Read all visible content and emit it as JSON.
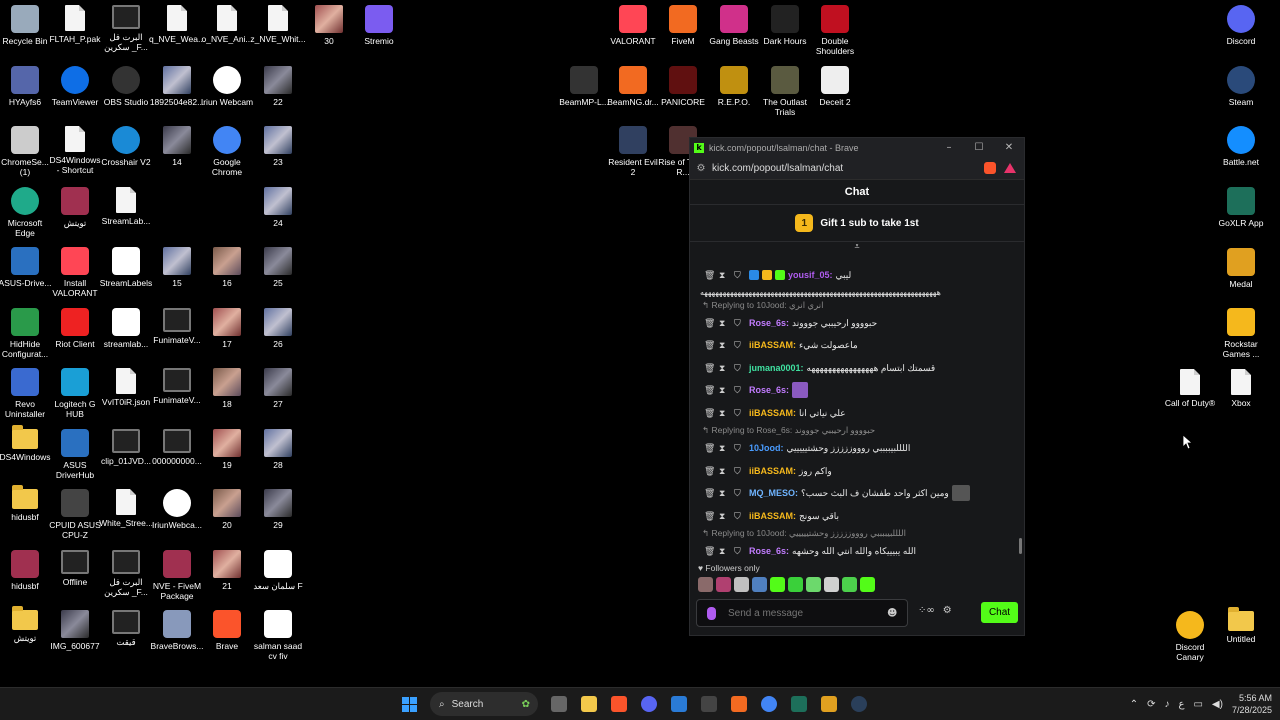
{
  "desktop": {
    "icons_left": [
      {
        "label": "Recycle Bin",
        "icon": "recycle-bin-icon"
      },
      {
        "label": "FLTAH_P.pak",
        "icon": "file-icon"
      },
      {
        "label": "البرت فل سكرين _F...",
        "icon": "video-icon"
      },
      {
        "label": "q_NVE_Wea...",
        "icon": "file-icon"
      },
      {
        "label": "o_NVE_Ani...",
        "icon": "file-icon"
      },
      {
        "label": "z_NVE_Whit...",
        "icon": "file-icon"
      },
      {
        "label": "30",
        "icon": "photo-icon"
      },
      {
        "label": "Stremio",
        "icon": "stremio-icon"
      },
      {
        "label": "HYAyfs6",
        "icon": "app-icon"
      },
      {
        "label": "TeamViewer",
        "icon": "teamviewer-icon"
      },
      {
        "label": "OBS Studio",
        "icon": "obs-icon"
      },
      {
        "label": "1892504e82...",
        "icon": "photo-icon"
      },
      {
        "label": "Iriun Webcam",
        "icon": "iriun-icon"
      },
      {
        "label": "22",
        "icon": "photo-icon"
      },
      {
        "label": "ChromeSe... (1)",
        "icon": "chrome-setup-icon"
      },
      {
        "label": "DS4Windows - Shortcut",
        "icon": "file-icon"
      },
      {
        "label": "Crosshair V2",
        "icon": "crosshair-icon"
      },
      {
        "label": "14",
        "icon": "photo-icon"
      },
      {
        "label": "Google Chrome",
        "icon": "chrome-icon"
      },
      {
        "label": "23",
        "icon": "photo-icon"
      },
      {
        "label": "Microsoft Edge",
        "icon": "edge-icon"
      },
      {
        "label": "تويتش",
        "icon": "winrar-icon"
      },
      {
        "label": "StreamLab...",
        "icon": "file-icon"
      },
      {
        "label": "24",
        "icon": "photo-icon"
      },
      {
        "label": "ASUS-Drive...",
        "icon": "asus-icon"
      },
      {
        "label": "Install VALORANT",
        "icon": "valorant-icon"
      },
      {
        "label": "StreamLabels",
        "icon": "streamlabels-icon"
      },
      {
        "label": "15",
        "icon": "photo-icon"
      },
      {
        "label": "16",
        "icon": "photo-icon"
      },
      {
        "label": "25",
        "icon": "photo-icon"
      },
      {
        "label": "HidHide Configurat...",
        "icon": "hidhide-icon"
      },
      {
        "label": "Riot Client",
        "icon": "riot-icon"
      },
      {
        "label": "streamlab...",
        "icon": "streamlabels-icon"
      },
      {
        "label": "FunimateV...",
        "icon": "video-icon"
      },
      {
        "label": "17",
        "icon": "photo-icon"
      },
      {
        "label": "26",
        "icon": "photo-icon"
      },
      {
        "label": "Revo Uninstaller",
        "icon": "revo-icon"
      },
      {
        "label": "Logitech G HUB",
        "icon": "logitech-icon"
      },
      {
        "label": "VvIT0iR.json",
        "icon": "file-icon"
      },
      {
        "label": "FunimateV...",
        "icon": "video-icon"
      },
      {
        "label": "18",
        "icon": "photo-icon"
      },
      {
        "label": "27",
        "icon": "photo-icon"
      },
      {
        "label": "DS4Windows",
        "icon": "folder-icon"
      },
      {
        "label": "ASUS DriverHub",
        "icon": "asus-icon"
      },
      {
        "label": "clip_01JVD...",
        "icon": "video-icon"
      },
      {
        "label": "000000000...",
        "icon": "video-icon"
      },
      {
        "label": "19",
        "icon": "photo-icon"
      },
      {
        "label": "28",
        "icon": "photo-icon"
      },
      {
        "label": "hidusbf",
        "icon": "folder-icon"
      },
      {
        "label": "CPUID ASUS CPU-Z",
        "icon": "cpuz-icon"
      },
      {
        "label": "White_Stree...",
        "icon": "file-icon"
      },
      {
        "label": "IriunWebca...",
        "icon": "iriun-icon"
      },
      {
        "label": "20",
        "icon": "photo-icon"
      },
      {
        "label": "29",
        "icon": "photo-icon"
      },
      {
        "label": "hidusbf",
        "icon": "winrar-icon"
      },
      {
        "label": "Offline",
        "icon": "video-icon"
      },
      {
        "label": "البرت فل سكرين _F...",
        "icon": "video-icon"
      },
      {
        "label": "NVE - FiveM Package",
        "icon": "winrar-icon"
      },
      {
        "label": "21",
        "icon": "photo-icon"
      },
      {
        "label": "سلمان سعد F",
        "icon": "pdf-icon"
      },
      {
        "label": "تويتش",
        "icon": "folder-icon"
      },
      {
        "label": "IMG_600677",
        "icon": "photo-icon"
      },
      {
        "label": "قيقت",
        "icon": "video-icon"
      },
      {
        "label": "BraveBrows...",
        "icon": "brave-setup-icon"
      },
      {
        "label": "Brave",
        "icon": "brave-icon"
      },
      {
        "label": "salman saad cv fiv",
        "icon": "pdf-icon"
      }
    ],
    "icons_middle": [
      {
        "label": "VALORANT",
        "icon": "valorant-icon"
      },
      {
        "label": "FiveM",
        "icon": "fivem-icon"
      },
      {
        "label": "Gang Beasts",
        "icon": "gang-beasts-icon"
      },
      {
        "label": "Dark Hours",
        "icon": "dark-hours-icon"
      },
      {
        "label": "Double Shoulders",
        "icon": "double-shoulders-icon"
      },
      {
        "label": "BeamMP-L...",
        "icon": "beammp-icon"
      },
      {
        "label": "BeamNG.dr...",
        "icon": "beamng-icon"
      },
      {
        "label": "PANICORE",
        "icon": "panicore-icon"
      },
      {
        "label": "R.E.P.O.",
        "icon": "repo-icon"
      },
      {
        "label": "The Outlast Trials",
        "icon": "outlast-icon"
      },
      {
        "label": "Deceit 2",
        "icon": "deceit-icon"
      },
      {
        "label": "Resident Evil 2",
        "icon": "resident-evil-icon"
      },
      {
        "label": "Rise of Tomb R...",
        "icon": "tomb-raider-icon"
      }
    ],
    "icons_right": [
      {
        "label": "Discord",
        "icon": "discord-icon"
      },
      {
        "label": "Steam",
        "icon": "steam-icon"
      },
      {
        "label": "Battle.net",
        "icon": "battlenet-icon"
      },
      {
        "label": "GoXLR App",
        "icon": "goxlr-icon"
      },
      {
        "label": "Medal",
        "icon": "medal-icon"
      },
      {
        "label": "Rockstar Games ...",
        "icon": "rockstar-icon"
      },
      {
        "label": "Call of Duty®",
        "icon": "file-icon"
      },
      {
        "label": "Xbox",
        "icon": "file-icon"
      },
      {
        "label": "Discord Canary",
        "icon": "discord-canary-icon"
      },
      {
        "label": "Untitled",
        "icon": "folder-icon"
      }
    ]
  },
  "browser": {
    "title": "kick.com/popout/lsalman/chat - Brave",
    "url": "kick.com/popout/lsalman/chat",
    "chat_header": "Chat",
    "gift_rank": "1",
    "gift_text": "Gift 1 sub to take 1st",
    "pin_icon": "chevron-down-icon",
    "messages": [
      {
        "reply": "",
        "user": "yousif_05",
        "color": "#b05cf0",
        "text": "ليبي",
        "wrap": "ههههههههههههههههههههههههههههههههههههههههههههههههههههههههههههههههه"
      },
      {
        "reply": "Replying to 10Jood: انري انري",
        "user": "Rose_6s",
        "color": "#c27cff",
        "text": "حبوووو ارحيببي جوووند",
        "wrap": ""
      },
      {
        "reply": "",
        "user": "iiBASSAM",
        "color": "#f5b81c",
        "text": "ماعصولت شيء",
        "wrap": ""
      },
      {
        "reply": "",
        "user": "jumana0001",
        "color": "#3fe0a0",
        "text": "قسمتك ابتسام ههههههههههههههههه",
        "wrap": ""
      },
      {
        "reply": "",
        "user": "Rose_6s",
        "color": "#c27cff",
        "text": "",
        "wrap": ""
      },
      {
        "reply": "",
        "user": "iiBASSAM",
        "color": "#f5b81c",
        "text": "علي نياتي انا",
        "wrap": ""
      },
      {
        "reply": "Replying to Rose_6s: حبوووو ارحيببي جوووند",
        "user": "10Jood",
        "color": "#4a9cff",
        "text": "اللللبيببببي روووززززز وحشتيييييي",
        "wrap": ""
      },
      {
        "reply": "",
        "user": "iiBASSAM",
        "color": "#f5b81c",
        "text": "واكم روز",
        "wrap": ""
      },
      {
        "reply": "",
        "user": "MQ_MESO",
        "color": "#6fb4ff",
        "text": "ومين اكثر واحد طفشان ف البث حسب؟",
        "wrap": ""
      },
      {
        "reply": "",
        "user": "iiBASSAM",
        "color": "#f5b81c",
        "text": "باقي سونج",
        "wrap": ""
      },
      {
        "reply": "Replying to 10Jood: اللللبيببببي روووززززز وحشتيييييي",
        "user": "Rose_6s",
        "color": "#c27cff",
        "text": "الله يبيييكاه والله انتي الله وحشهه",
        "wrap": ""
      }
    ],
    "followers_label": "Followers only",
    "input_placeholder": "Send a message",
    "send_label": "Chat"
  },
  "taskbar": {
    "search_label": "Search",
    "language": "ع",
    "time": "5:56 AM",
    "date": "7/28/2025"
  },
  "colors": {
    "kick_green": "#53fc18",
    "panel_bg": "#17181a"
  }
}
